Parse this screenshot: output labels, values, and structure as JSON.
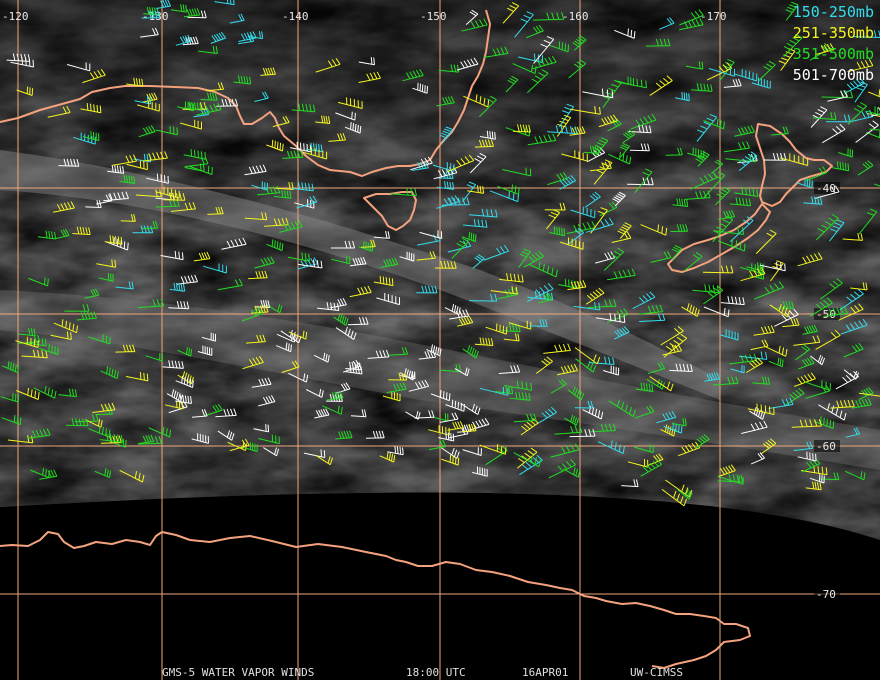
{
  "colors": {
    "grid": "#f0a67a",
    "coast": "#f4a27e",
    "cyan": "#33ddee",
    "yellow": "#f6f61e",
    "green": "#22dd22",
    "white": "#ffffff"
  },
  "longitude_labels": [
    "-120",
    "-130",
    "-140",
    "-150",
    "-160",
    "-170"
  ],
  "latitude_labels": [
    "-40",
    "-50",
    "-60",
    "-70"
  ],
  "legend": [
    {
      "label": "150-250mb",
      "color": "#33ddee"
    },
    {
      "label": "251-350mb",
      "color": "#f6f61e"
    },
    {
      "label": "351-500mb",
      "color": "#22dd22"
    },
    {
      "label": "501-700mb",
      "color": "#ffffff"
    }
  ],
  "footer": {
    "satellite": "GMS-5 WATER VAPOR WINDS",
    "time": "18:00 UTC",
    "date": "16APR01",
    "credit": "UW-CIMSS"
  },
  "icons": {
    "wind_barb": "wind-barb-icon"
  }
}
